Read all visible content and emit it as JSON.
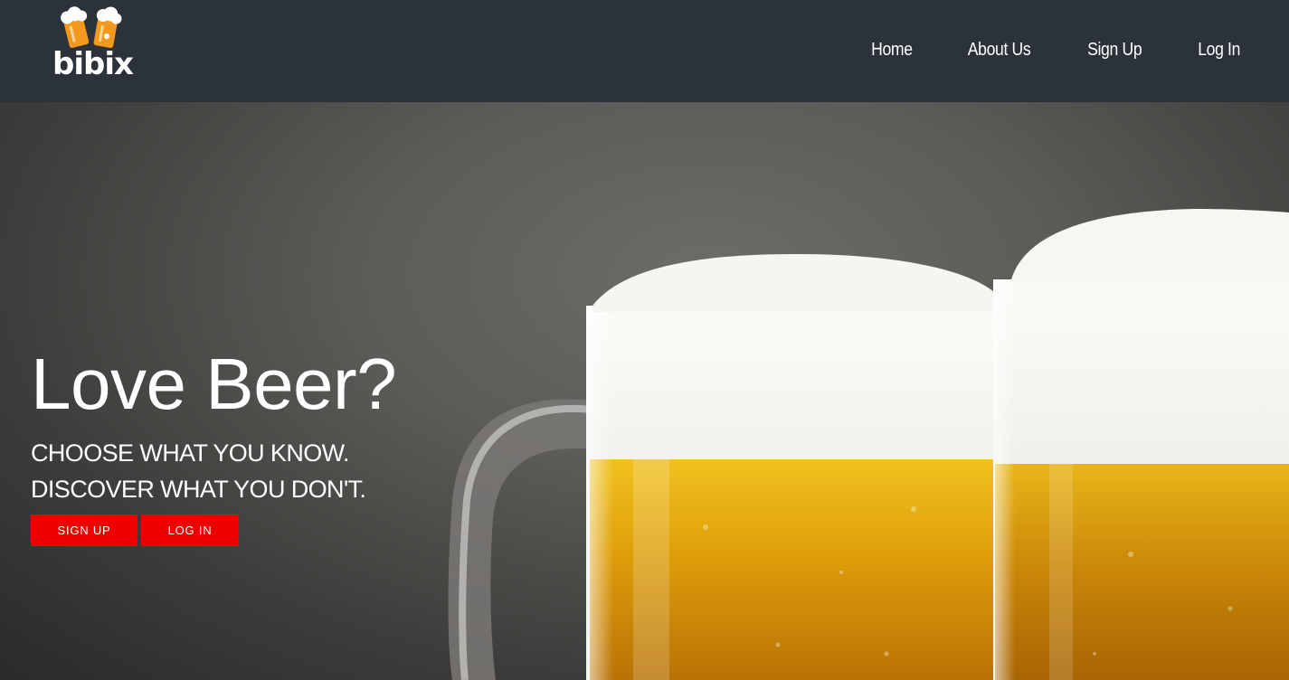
{
  "brand": {
    "name": "bibix"
  },
  "nav": {
    "items": [
      "Home",
      "About Us",
      "Sign Up",
      "Log In"
    ]
  },
  "hero": {
    "headline": "Love Beer?",
    "tagline_line1": "CHOOSE WHAT YOU KNOW.",
    "tagline_line2": "DISCOVER WHAT YOU DON'T.",
    "signup_label": "SIGN UP",
    "login_label": "LOG IN"
  },
  "colors": {
    "topbar": "#2c323a",
    "accent": "#ee0000",
    "logo_orange": "#f39a1e"
  },
  "icons": {
    "logo": "beer-mugs-logo-icon"
  }
}
